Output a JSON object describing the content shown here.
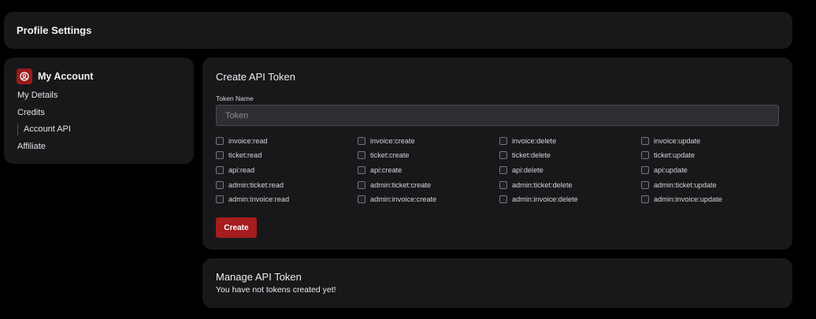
{
  "header": {
    "title": "Profile Settings"
  },
  "sidebar": {
    "account_title": "My Account",
    "items": [
      {
        "label": "My Details",
        "active": false
      },
      {
        "label": "Credits",
        "active": false
      },
      {
        "label": "Account API",
        "active": true
      },
      {
        "label": "Affiliate",
        "active": false
      }
    ]
  },
  "create_token": {
    "title": "Create API Token",
    "field_label": "Token Name",
    "placeholder": "Token",
    "value": "",
    "permissions": [
      "invoice:read",
      "invoice:create",
      "invoice:delete",
      "invoice:update",
      "ticket:read",
      "ticket:create",
      "ticket:delete",
      "ticket:update",
      "api:read",
      "api:create",
      "api:delete",
      "api:update",
      "admin:ticket:read",
      "admin:ticket:create",
      "admin:ticket:delete",
      "admin:ticket:update",
      "admin:invoice:read",
      "admin:invoice:create",
      "admin:invoice:delete",
      "admin:invoice:update"
    ],
    "button_label": "Create"
  },
  "manage_token": {
    "title": "Manage API Token",
    "empty_message": "You have not tokens created yet!"
  },
  "colors": {
    "background": "#000000",
    "card": "#18181b",
    "accent": "#a51d1d"
  },
  "icons": {
    "account": "user-circle-icon"
  }
}
